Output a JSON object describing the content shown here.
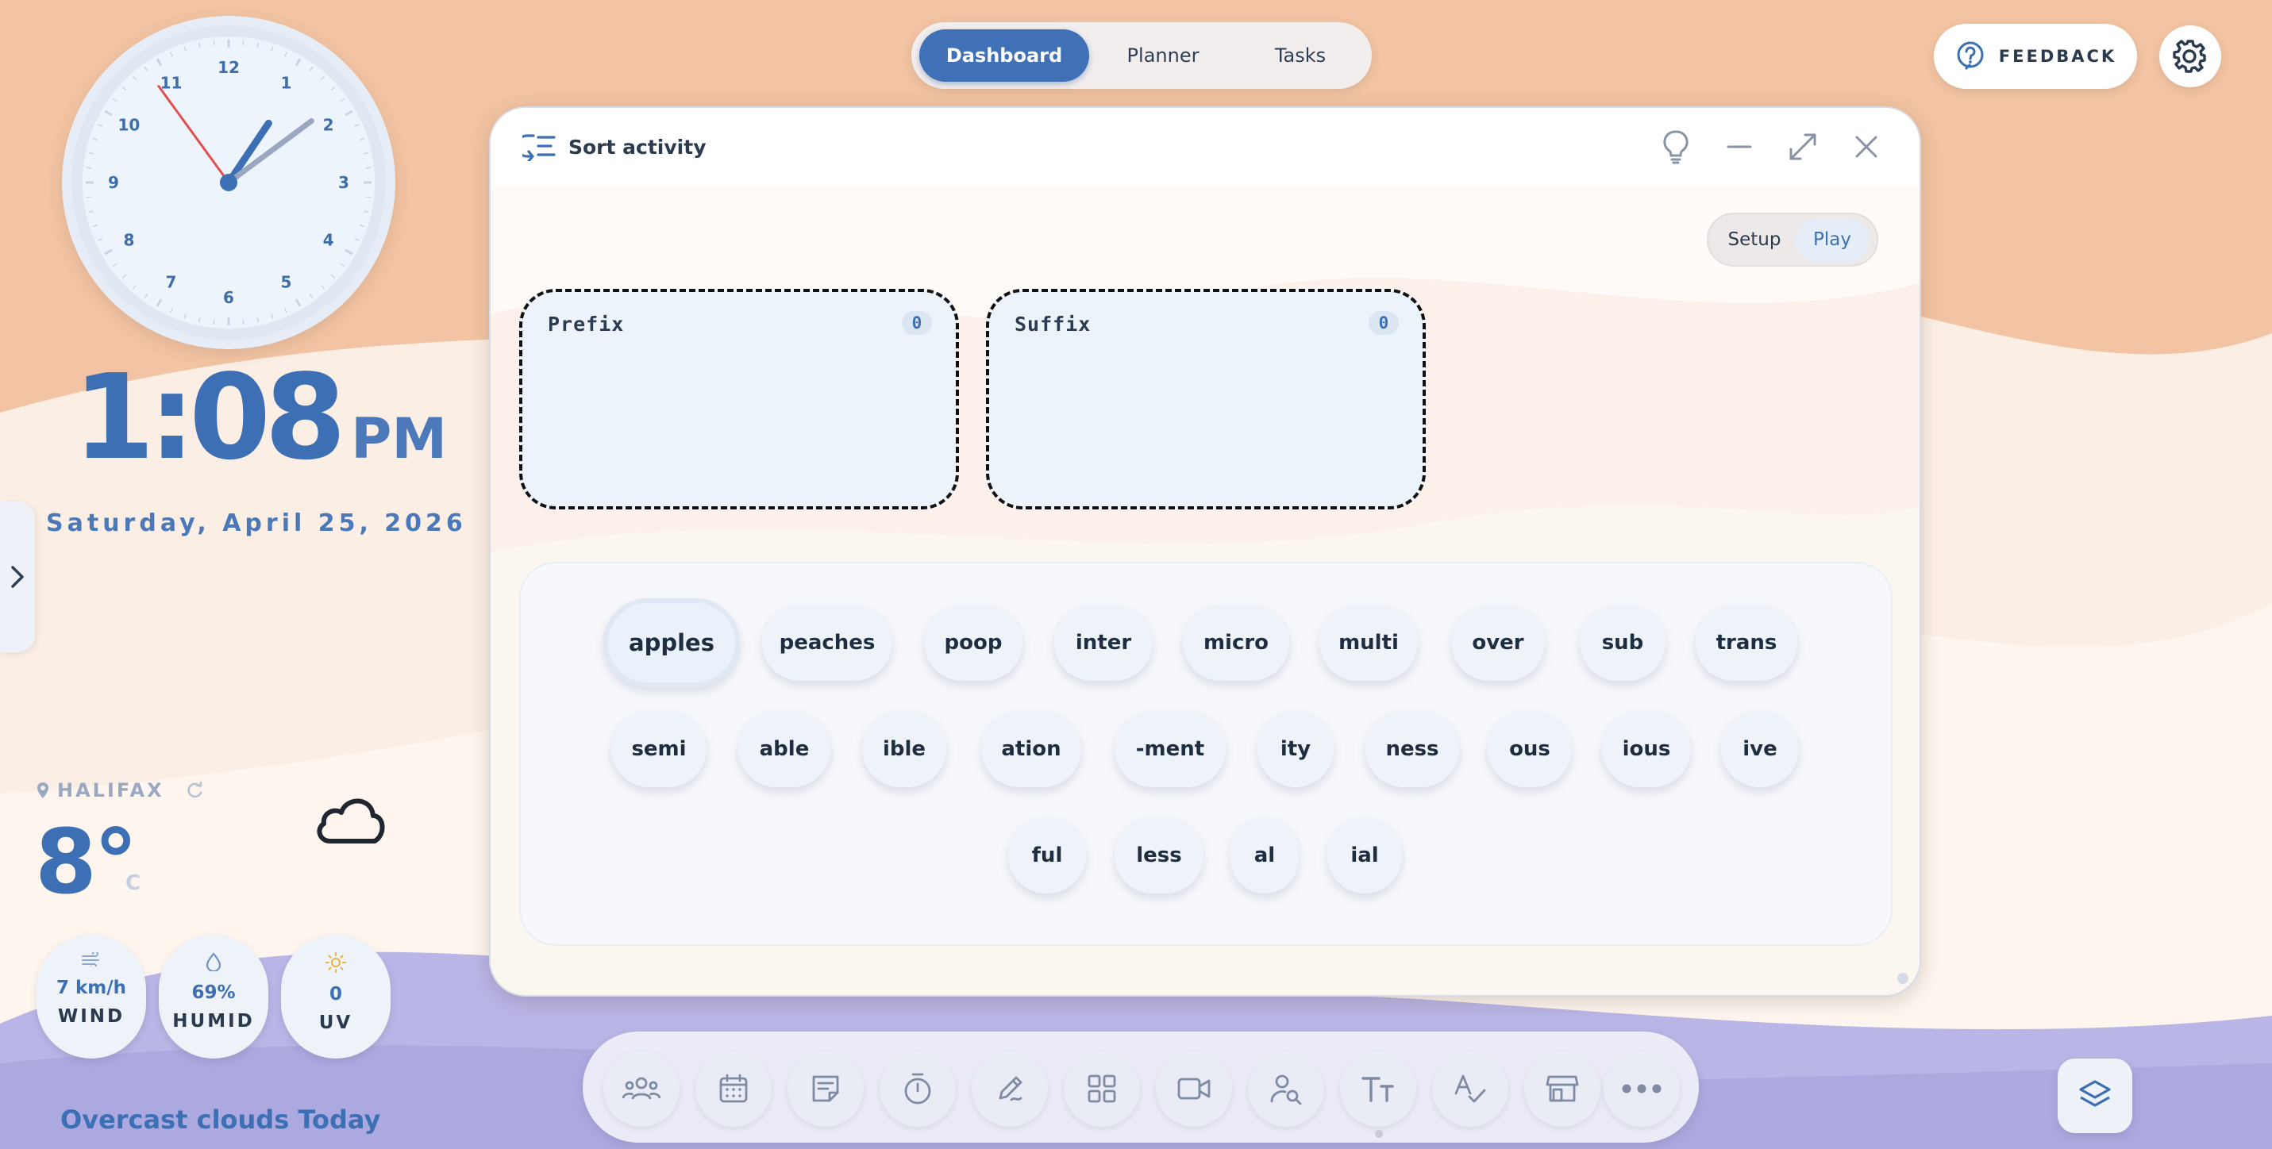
{
  "clock": {
    "numbers": [
      "12",
      "1",
      "2",
      "3",
      "4",
      "5",
      "6",
      "7",
      "8",
      "9",
      "10",
      "11"
    ],
    "hour": 1,
    "minute": 8,
    "second": 54
  },
  "time": {
    "hm": "1:08",
    "ampm": "PM"
  },
  "date": "Saturday, April 25, 2026",
  "weather": {
    "city": "HALIFAX",
    "temp": "8°",
    "unit": "C",
    "wind": {
      "value": "7 km/h",
      "label": "WIND"
    },
    "humidity": {
      "value": "69%",
      "label": "HUMID"
    },
    "uv": {
      "value": "0",
      "label": "UV"
    },
    "description": "Overcast clouds Today"
  },
  "nav": {
    "tabs": [
      "Dashboard",
      "Planner",
      "Tasks"
    ],
    "active": "Dashboard"
  },
  "feedback_label": "FEEDBACK",
  "activity": {
    "title": "Sort activity",
    "modes": [
      "Setup",
      "Play"
    ],
    "active_mode": "Play",
    "buckets": [
      {
        "label": "Prefix",
        "count": "0"
      },
      {
        "label": "Suffix",
        "count": "0"
      }
    ],
    "rows": [
      [
        "apples",
        "peaches",
        "poop",
        "inter",
        "micro",
        "multi",
        "over",
        "sub",
        "trans"
      ],
      [
        "semi",
        "able",
        "ible",
        "ation",
        "-ment",
        "ity",
        "ness",
        "ous",
        "ious",
        "ive"
      ],
      [
        "ful",
        "less",
        "al",
        "ial"
      ]
    ]
  },
  "dock_icons": [
    "group-icon",
    "calendar-icon",
    "note-icon",
    "timer-icon",
    "draw-icon",
    "grid-icon",
    "video-icon",
    "search-person-icon",
    "text-size-icon",
    "spell-check-icon",
    "store-icon",
    "more-icon"
  ],
  "colors": {
    "accent": "#4070b5",
    "text": "#2b3a4f",
    "bucket_bg": "#edf3fb"
  }
}
